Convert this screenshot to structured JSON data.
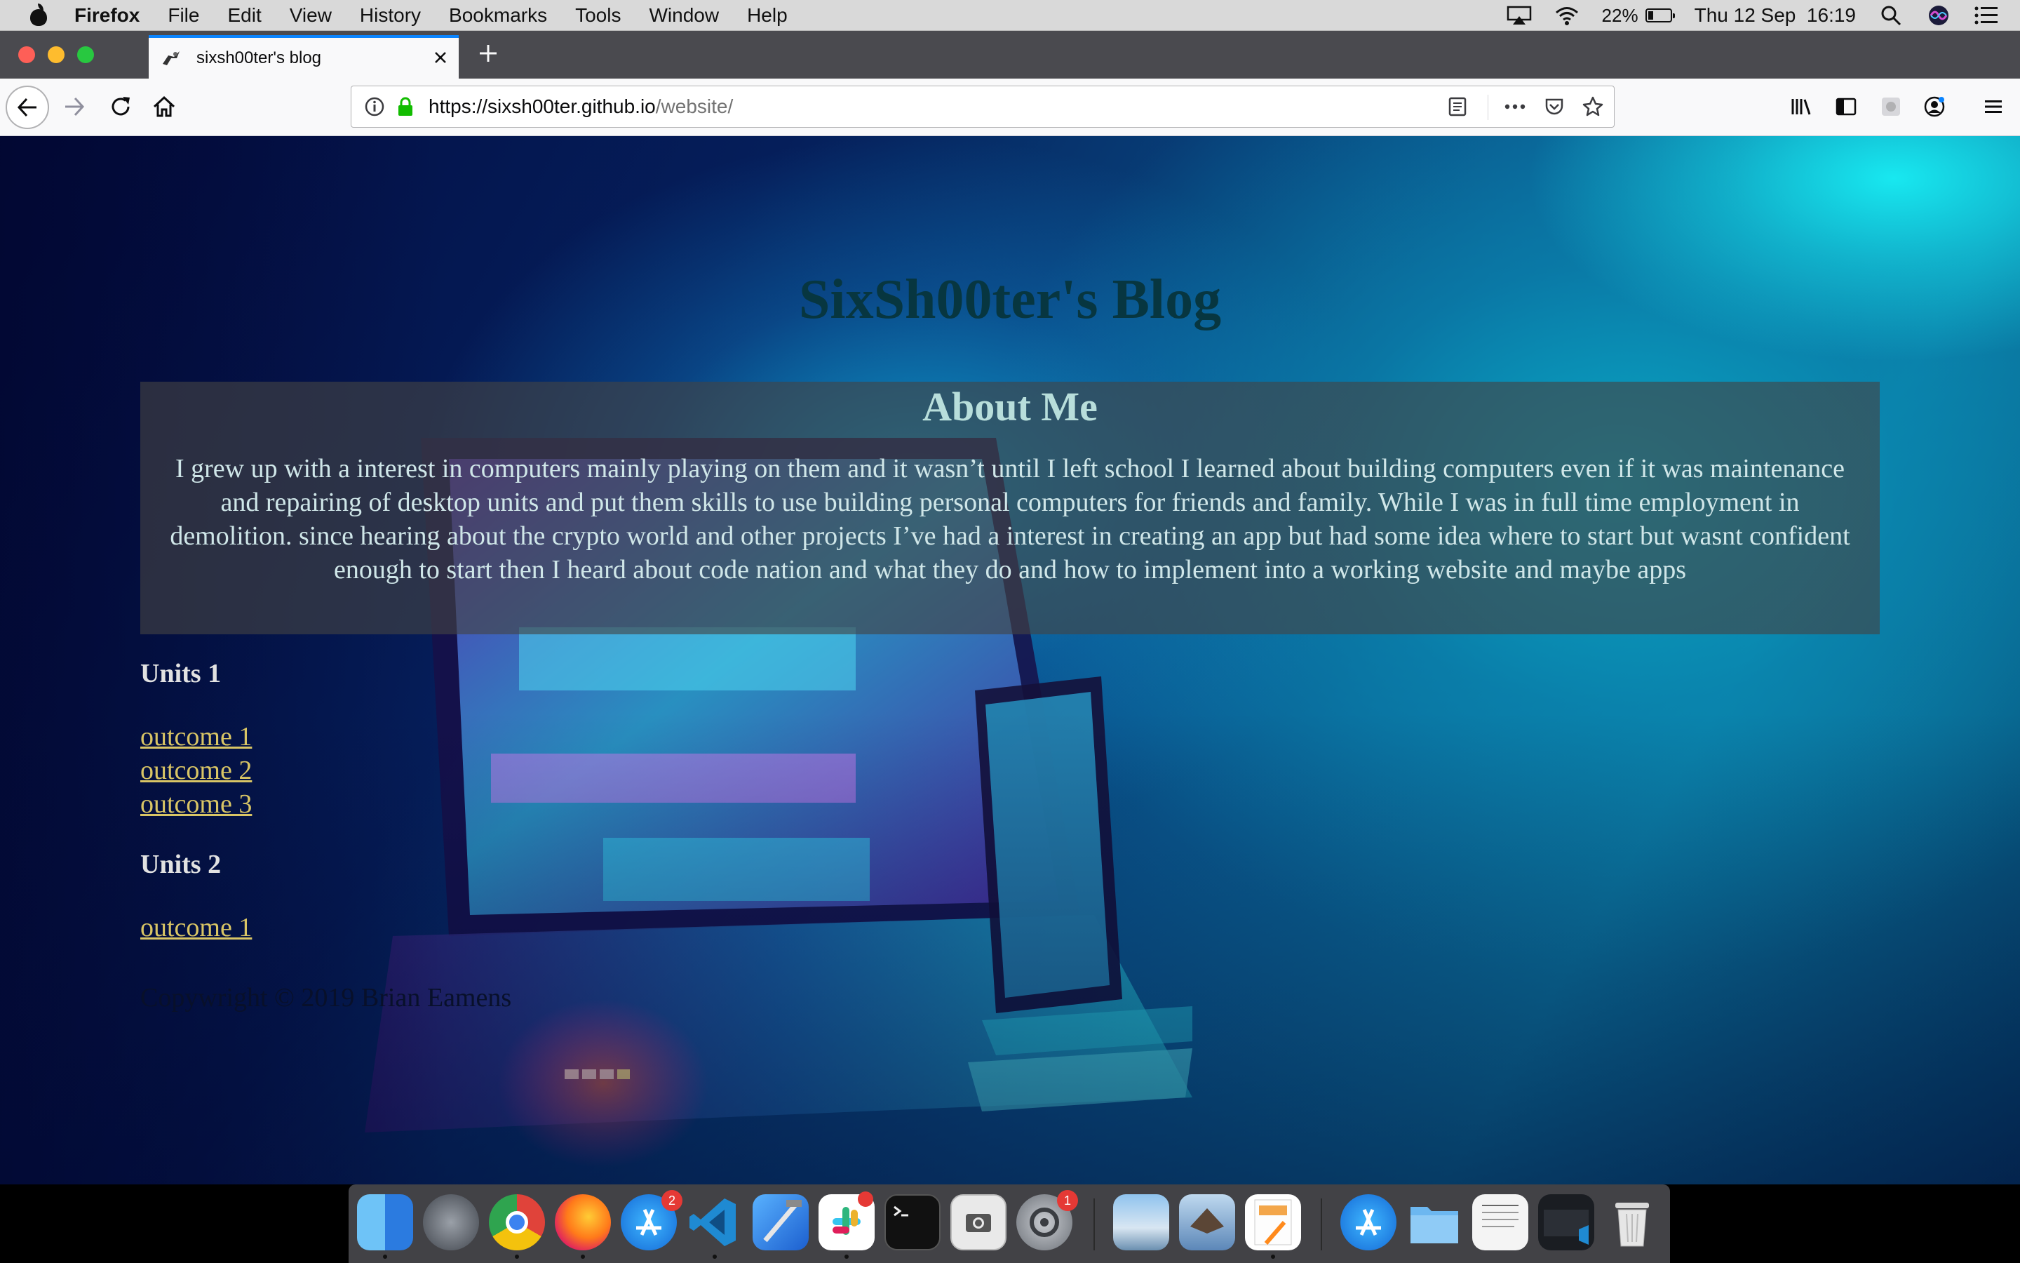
{
  "menubar": {
    "app_name": "Firefox",
    "items": [
      "File",
      "Edit",
      "View",
      "History",
      "Bookmarks",
      "Tools",
      "Window",
      "Help"
    ],
    "battery_percent": "22%",
    "datetime": "Thu 12 Sep  16:19"
  },
  "browser": {
    "tab_title": "sixsh00ter's blog",
    "url_host": "https://sixsh00ter.github.io",
    "url_path": "/website/"
  },
  "page": {
    "title": "SixSh00ter's Blog",
    "about_heading": "About Me",
    "about_text": "I grew up with a interest in computers mainly playing on them and it wasn’t until I left school I learned about building computers even if it was maintenance and repairing of desktop units and put them skills to use building personal computers for friends and family. While I was in full time employment in demolition. since hearing about the crypto world and other projects I’ve had a interest in creating an app but had some idea where to start but wasnt confident enough to start then I heard about code nation and what they do and how to implement into a working website and maybe apps",
    "units": [
      {
        "heading": "Units 1",
        "outcomes": [
          "outcome 1",
          "outcome 2",
          "outcome 3"
        ]
      },
      {
        "heading": "Units 2",
        "outcomes": [
          "outcome 1"
        ]
      }
    ],
    "copyright": "Copywright © 2019 Brian Eamens"
  },
  "dock": {
    "badges": {
      "app_store": "2",
      "slack": "",
      "system_prefs": "1"
    }
  },
  "colors": {
    "accent": "#0a84ff",
    "link": "#d9c565",
    "title": "#073640"
  }
}
